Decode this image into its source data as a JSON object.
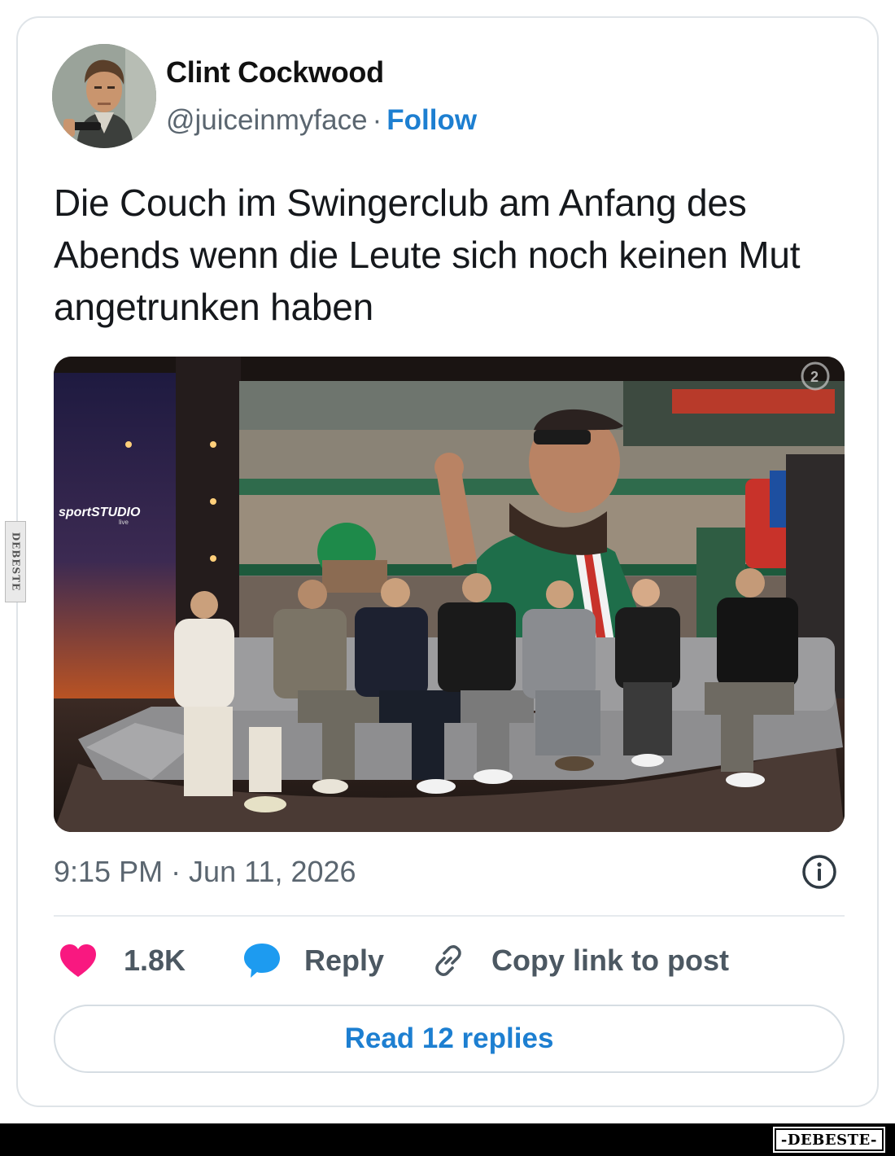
{
  "post": {
    "author": {
      "display_name": "Clint Cockwood",
      "handle": "@juiceinmyface",
      "separator": "·",
      "follow_label": "Follow"
    },
    "text": "Die Couch im Swingerclub am Anfang des Abends wenn die Leute sich noch keinen Mut angetrunken haben",
    "media": {
      "description_tags": [
        "tv-studio-panel",
        "stadium-screen",
        "celebrating-fan"
      ],
      "overlay_logo_text": "sportSTUDIO",
      "overlay_logo_sub": "live",
      "channel_bug": "2"
    },
    "timestamp": "9:15 PM · Jun 11, 2026",
    "info_icon": "info-icon",
    "actions": {
      "like": {
        "icon": "heart-icon",
        "count": "1.8K",
        "color": "#f91880"
      },
      "reply": {
        "icon": "speech-bubble-icon",
        "label": "Reply",
        "color": "#1d9bf0"
      },
      "copy": {
        "icon": "link-icon",
        "label": "Copy link to post"
      }
    },
    "read_replies_label": "Read 12 replies"
  },
  "watermark": {
    "side_text": "DEBESTE",
    "footer_text": "-DEBESTE-"
  },
  "colors": {
    "link_blue": "#1d7fd1",
    "secondary_text": "#5b6670",
    "border": "#dfe4e8"
  }
}
